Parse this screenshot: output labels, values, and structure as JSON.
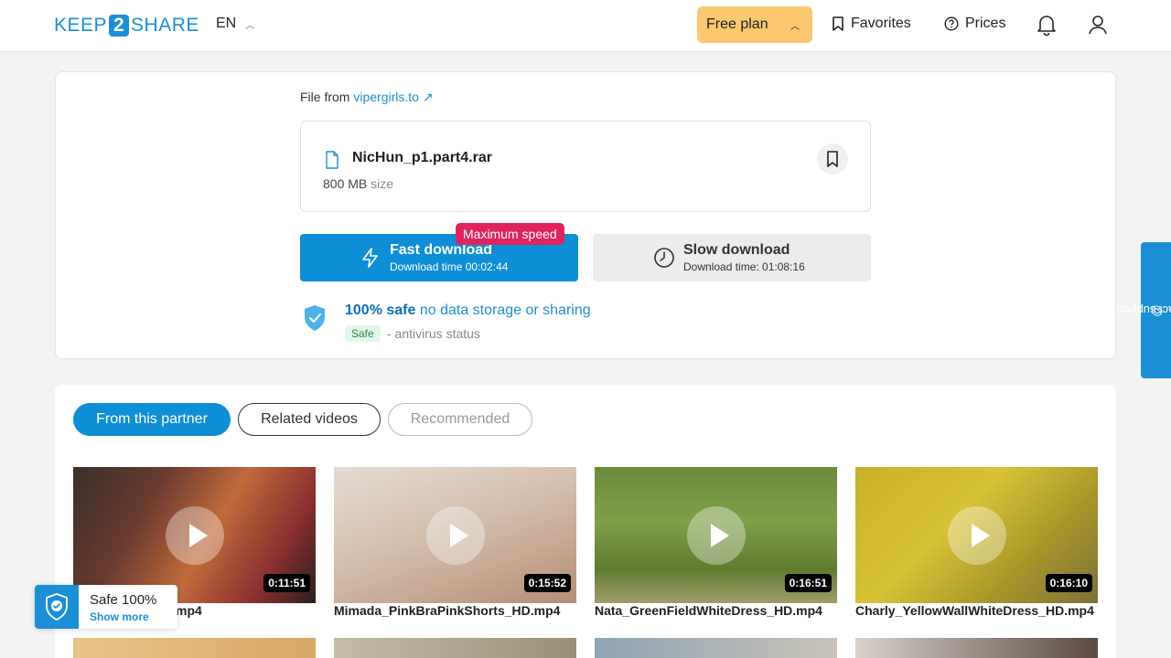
{
  "header": {
    "logo_left": "KEEP",
    "logo_mid": "2",
    "logo_right": "SHARE",
    "language": "EN",
    "plan": "Free plan",
    "favorites": "Favorites",
    "prices": "Prices"
  },
  "file": {
    "from_label": "File from",
    "from_site": "vipergirls.to",
    "name": "NicHun_p1.part4.rar",
    "size": "800 MB",
    "size_unit": "size"
  },
  "download": {
    "fast_title": "Fast download",
    "fast_time": "Download time 00:02:44",
    "badge": "Maximum speed",
    "slow_title": "Slow download",
    "slow_time": "Download time: 01:08:16"
  },
  "safety": {
    "strong": "100% safe",
    "rest": "no data storage or sharing",
    "tag": "Safe",
    "antivirus": "- antivirus status"
  },
  "contact": "contact support",
  "tabs": [
    "From this partner",
    "Related videos",
    "Recommended"
  ],
  "videos": [
    {
      "name": "LAMB_ 3001_hd.mp4",
      "visible_name": "3001_hd.mp4",
      "duration": "0:11:51"
    },
    {
      "name": "Mimada_PinkBraPinkShorts_HD.mp4",
      "duration": "0:15:52"
    },
    {
      "name": "Nata_GreenFieldWhiteDress_HD.mp4",
      "duration": "0:16:51"
    },
    {
      "name": "Charly_YellowWallWhiteDress_HD.mp4",
      "duration": "0:16:10"
    }
  ],
  "safe_widget": {
    "title": "Safe 100%",
    "link": "Show more"
  },
  "colors": {
    "brand": "#1a8fd6",
    "plan_bg": "#fbc870",
    "badge": "#e0245e"
  }
}
